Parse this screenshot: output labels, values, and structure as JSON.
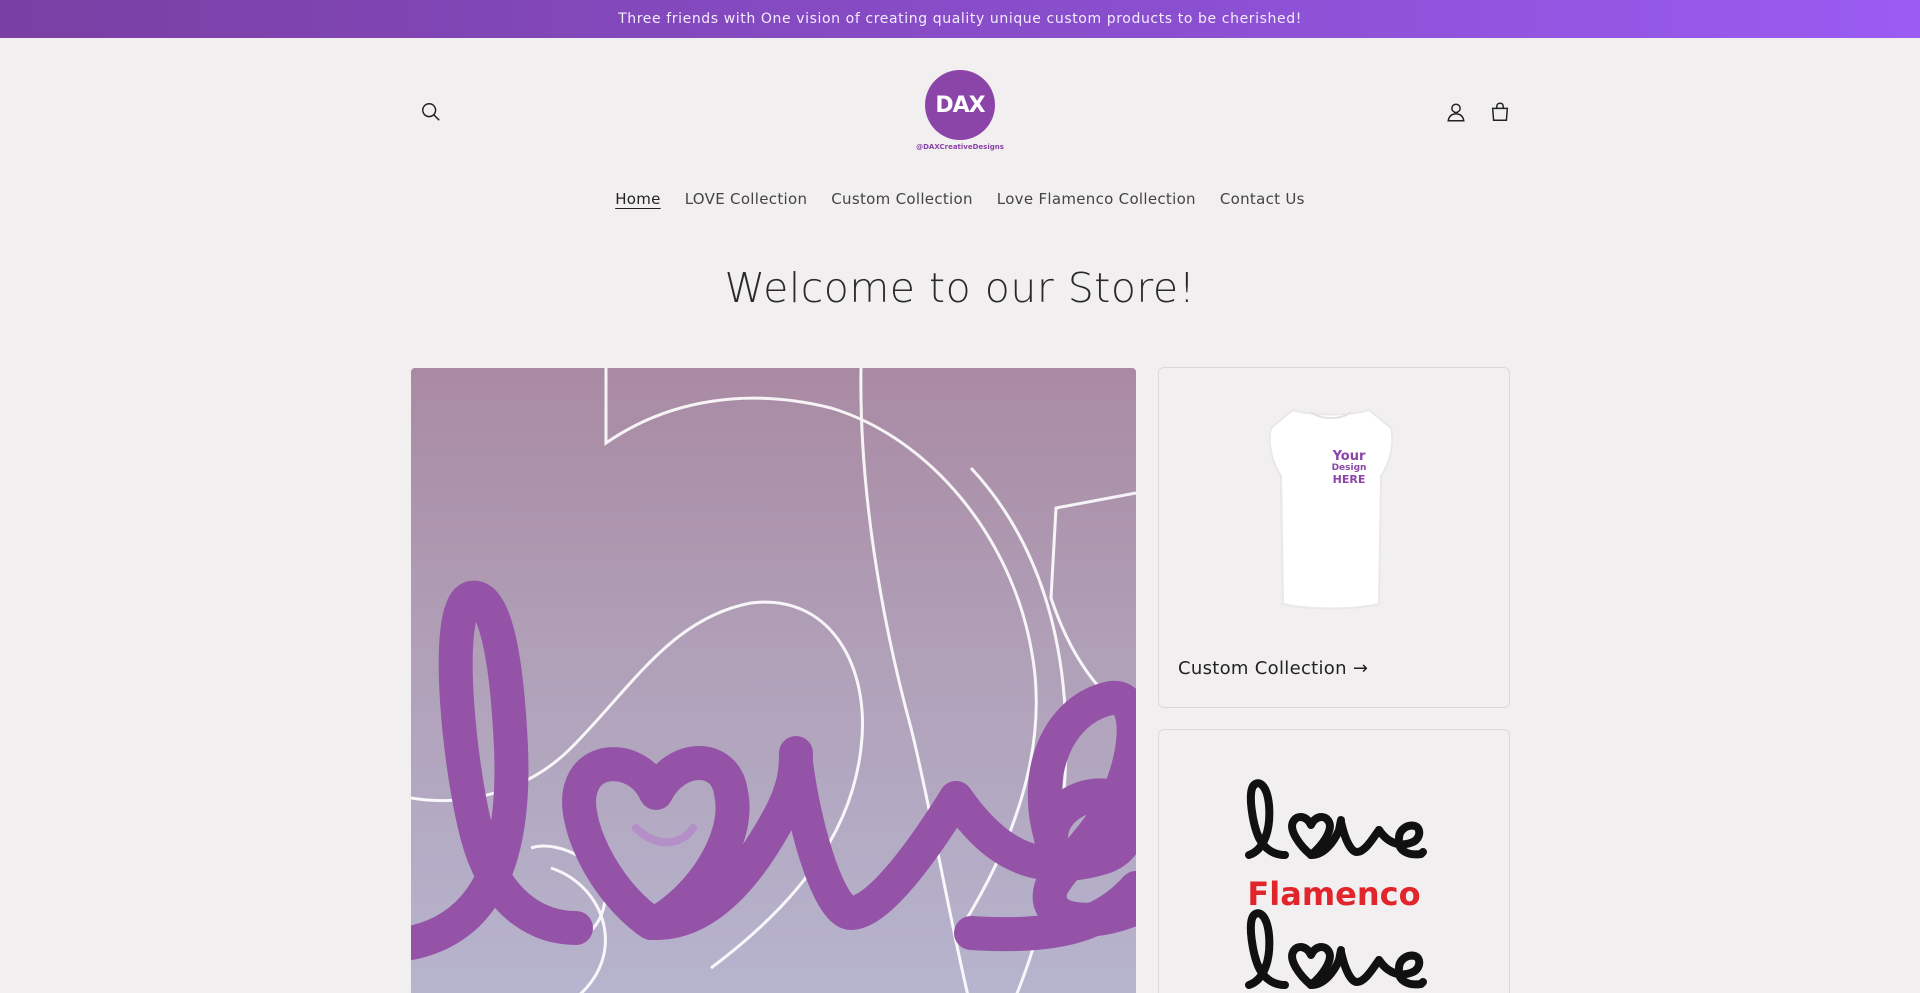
{
  "announcement": {
    "text": "Three friends with One vision of creating quality unique custom products to be cherished!"
  },
  "header": {
    "logo": {
      "mark": "DAX",
      "tagline": "@DAXCreativeDesigns"
    },
    "icons": {
      "search": "search-icon",
      "account": "account-icon",
      "cart": "cart-icon"
    }
  },
  "nav": {
    "items": [
      {
        "label": "Home",
        "active": true
      },
      {
        "label": "LOVE Collection",
        "active": false
      },
      {
        "label": "Custom Collection",
        "active": false
      },
      {
        "label": "Love Flamenco Collection",
        "active": false
      },
      {
        "label": "Contact Us",
        "active": false
      }
    ]
  },
  "main": {
    "heading": "Welcome to our Store!",
    "featured_image": {
      "word": "love"
    },
    "collections": [
      {
        "title": "Custom Collection →",
        "image_text": [
          "Your",
          "Design",
          "HERE"
        ]
      },
      {
        "title": "",
        "image_text": [
          "love",
          "Flamenco",
          "love"
        ]
      }
    ]
  },
  "colors": {
    "accent": "#8b44a8",
    "announcement_start": "#7a3fa3",
    "announcement_end": "#9a5cf2",
    "background": "#f1eff0",
    "flamenco_red": "#e2252b"
  }
}
